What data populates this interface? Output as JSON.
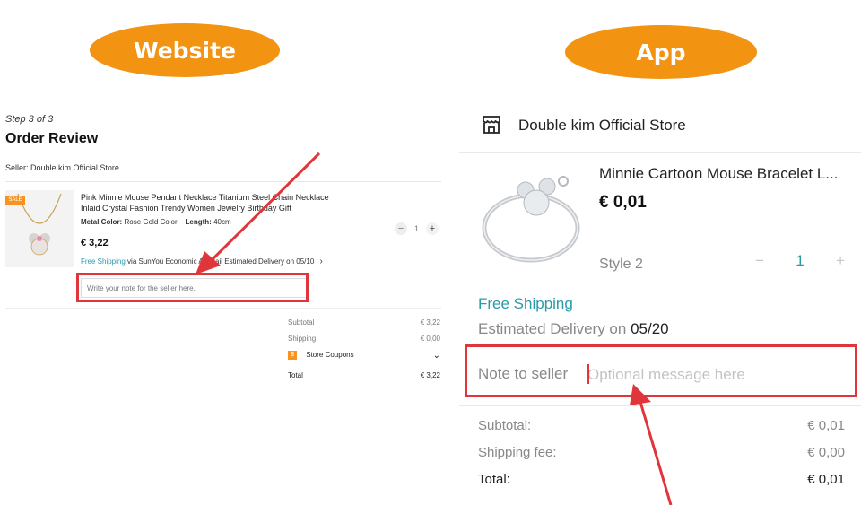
{
  "labels": {
    "website": "Website",
    "app": "App"
  },
  "website": {
    "step": "Step 3 of 3",
    "title": "Order Review",
    "seller": "Seller: Double kim Official Store",
    "product": {
      "name": "Pink Minnie Mouse Pendant Necklace Titanium Steel Chain Necklace Inlaid Crystal Fashion Trendy Women Jewelry Birthday Gift",
      "metal_color_label": "Metal Color:",
      "metal_color": "Rose Gold Color",
      "length_label": "Length:",
      "length": "40cm",
      "price": "€ 3,22",
      "free_shipping": "Free Shipping",
      "shipping_detail": "via SunYou Economic Air Mail  Estimated Delivery on 05/10",
      "quantity": "1"
    },
    "note_placeholder": "Write your note for the seller here.",
    "summary": {
      "subtotal_label": "Subtotal",
      "subtotal": "€ 3,22",
      "shipping_label": "Shipping",
      "shipping": "€ 0,00",
      "coupons_label": "Store Coupons",
      "total_label": "Total",
      "total": "€ 3,22"
    }
  },
  "app": {
    "store_name": "Double kim Official Store",
    "product_name": "Minnie Cartoon Mouse Bracelet L...",
    "price": "€ 0,01",
    "style": "Style 2",
    "quantity": "1",
    "free_shipping": "Free Shipping",
    "eta_label": "Estimated Delivery on",
    "eta_date": "05/20",
    "note_label": "Note to seller",
    "note_placeholder": "Optional message here",
    "summary": {
      "subtotal_label": "Subtotal:",
      "subtotal": "€ 0,01",
      "shipping_label": "Shipping fee:",
      "shipping": "€ 0,00",
      "total_label": "Total:",
      "total": "€ 0,01"
    }
  },
  "colors": {
    "accent_orange": "#f29312",
    "annotation_red": "#e0363b",
    "link_teal": "#2a9aa8"
  },
  "icons": [
    "store-icon",
    "chevron-right-icon",
    "chevron-down-icon",
    "coupon-icon",
    "minus-icon",
    "plus-icon"
  ]
}
